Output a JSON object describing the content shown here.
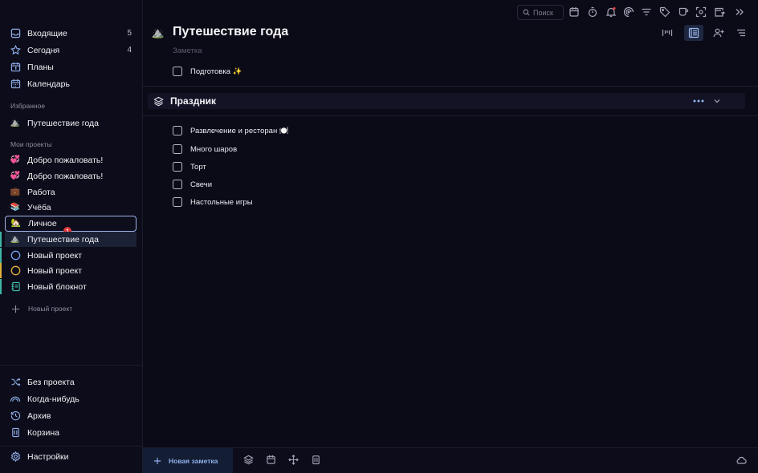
{
  "sidebar": {
    "top_items": [
      {
        "label": "Входящие",
        "count": "5",
        "icon": "inbox-icon"
      },
      {
        "label": "Сегодня",
        "count": "4",
        "icon": "star-icon"
      },
      {
        "label": "Планы",
        "count": "",
        "icon": "calendar-day-icon"
      },
      {
        "label": "Календарь",
        "count": "",
        "icon": "calendar-icon"
      }
    ],
    "favorites_header": "Избранное",
    "favorites": [
      {
        "label": "Путешествие года",
        "emoji": "⛰️"
      }
    ],
    "projects_header": "Мои проекты",
    "projects": [
      {
        "label": "Добро пожаловать!",
        "emoji": "💞",
        "bar_color": ""
      },
      {
        "label": "Добро пожаловать!",
        "emoji": "💞",
        "bar_color": ""
      },
      {
        "label": "Работа",
        "emoji": "💼",
        "bar_color": ""
      },
      {
        "label": "Учёба",
        "emoji": "📚",
        "bar_color": ""
      },
      {
        "label": "Личное",
        "emoji": "🏡",
        "bar_color": "",
        "state": "selected"
      },
      {
        "label": "Путешествие года",
        "emoji": "⛰️",
        "bar_color": "#3fb8a6",
        "state": "active"
      },
      {
        "label": "Новый проект",
        "emoji": "",
        "bar_color": "#3fb8a6",
        "ring_color": "#6fa2ee"
      },
      {
        "label": "Новый проект",
        "emoji": "",
        "bar_color": "#e0b13a",
        "ring_color": "#e0b13a"
      },
      {
        "label": "Новый блокнот",
        "emoji": "",
        "bar_color": "#3fb8a6",
        "icon": "notebook-icon"
      }
    ],
    "badge": "1",
    "new_project_label": "Новый проект",
    "bottom_items": [
      {
        "label": "Без проекта",
        "icon": "shuffle-icon"
      },
      {
        "label": "Когда-нибудь",
        "icon": "rainbow-icon"
      },
      {
        "label": "Архив",
        "icon": "history-icon"
      },
      {
        "label": "Корзина",
        "icon": "trash-icon"
      }
    ],
    "settings_label": "Настройки"
  },
  "toolbar": {
    "search_placeholder": "Поиск",
    "icons": [
      "calendar-icon",
      "timer-icon",
      "bell-icon",
      "focus-icon",
      "filter-icon",
      "tag-icon",
      "coffee-icon",
      "screenshot-icon",
      "calendar-export-icon",
      "expand-icon"
    ]
  },
  "project": {
    "emoji": "⛰️",
    "title": "Путешествие года",
    "subtitle": "Заметка",
    "tasks_top": [
      {
        "label": "Подготовка ✨"
      }
    ],
    "section": {
      "title": "Праздник",
      "tasks": [
        {
          "label": "Развлечение и ресторан 🍽️"
        },
        {
          "label": "Много шаров"
        },
        {
          "label": "Торт"
        },
        {
          "label": "Свечи"
        },
        {
          "label": "Настольные игры"
        }
      ]
    }
  },
  "bottom_bar": {
    "new_note_label": "Новая заметка"
  },
  "colors": {
    "accent": "#9fb8ec",
    "teal": "#3fb8a6",
    "yellow": "#e0b13a",
    "badge_red": "#e23a3a"
  }
}
